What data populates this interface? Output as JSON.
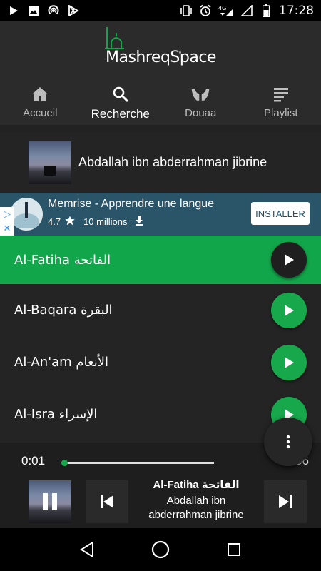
{
  "status_bar": {
    "time": "17:28",
    "icons": [
      "play-icon",
      "image-icon",
      "hotspot-icon",
      "play-store-icon",
      "vibrate-icon",
      "alarm-icon",
      "4g-signal-icon",
      "signal-icon",
      "battery-icon"
    ],
    "network_label": "4G"
  },
  "app": {
    "logo_text": "MashreqSpace",
    "accent_color": "#12a64a"
  },
  "tabs": [
    {
      "label": "Accueil",
      "icon": "home-icon",
      "active": false
    },
    {
      "label": "Recherche",
      "icon": "search-icon",
      "active": true
    },
    {
      "label": "Douaa",
      "icon": "praying-hands-icon",
      "active": false
    },
    {
      "label": "Playlist",
      "icon": "playlist-icon",
      "active": false
    }
  ],
  "reciter": {
    "name": "Abdallah ibn abderrahman jibrine"
  },
  "ad": {
    "title": "Memrise - Apprendre une langue",
    "rating": "4.7",
    "downloads": "10 millions",
    "install_label": "INSTALLER"
  },
  "surahs": [
    {
      "name": "Al-Fatiha",
      "arabic": "الفاتحة",
      "active": true
    },
    {
      "name": "Al-Baqara",
      "arabic": "البقرة",
      "active": false
    },
    {
      "name": "Al-An'am",
      "arabic": "الأنعام",
      "active": false
    },
    {
      "name": "Al-Isra",
      "arabic": "الإسراء",
      "active": false
    }
  ],
  "player": {
    "current_time": "0:01",
    "duration": "0:56",
    "progress": 0.02,
    "title": "Al-Fatiha الفاتحة",
    "artist": "Abdallah ibn abderrahman jibrine"
  }
}
